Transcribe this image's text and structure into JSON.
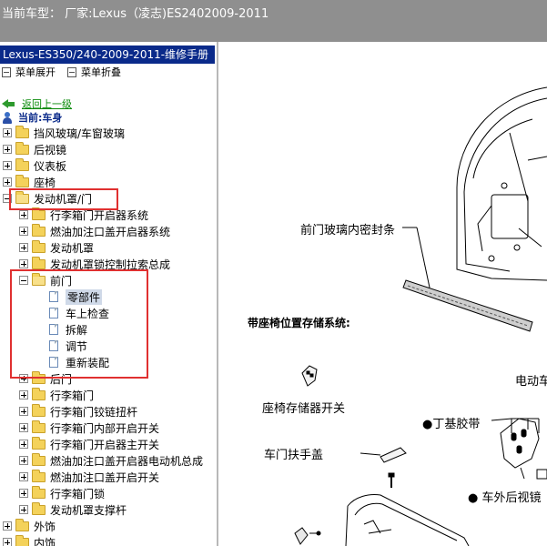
{
  "window": {
    "title": "当前车型：  厂家:Lexus（凌志)ES2402009-2011"
  },
  "manual": {
    "header": "Lexus-ES350/240-2009-2011-维修手册"
  },
  "toolbar": {
    "expand_label": "菜单展开",
    "collapse_label": "菜单折叠"
  },
  "nav": {
    "back_label": "返回上一级",
    "current_label": "当前:车身"
  },
  "tree": {
    "top_items": [
      "挡风玻璃/车窗玻璃",
      "后视镜",
      "仪表板",
      "座椅"
    ],
    "open_folder": "发动机罩/门",
    "children_a": [
      "行李箱门开启器系统",
      "燃油加注口盖开启器系统",
      "发动机罩",
      "发动机罩锁控制拉索总成"
    ],
    "front_door": "前门",
    "front_door_docs": [
      "零部件",
      "车上检查",
      "拆解",
      "调节",
      "重新装配"
    ],
    "children_b": [
      "后门",
      "行李箱门",
      "行李箱门铰链扭杆",
      "行李箱门内部开启开关",
      "行李箱门开启器主开关",
      "燃油加注口盖开启器电动机总成",
      "燃油加注口盖开启开关",
      "行李箱门锁",
      "发动机罩支撑杆"
    ],
    "bottom_items": [
      "外饰",
      "内饰"
    ]
  },
  "diagram": {
    "label_seal": "前门玻璃内密封条",
    "label_memory": "带座椅位置存储系统:",
    "label_electric": "电动车",
    "label_seat_switch": "座椅存储器开关",
    "label_butyl": "●丁基胶带",
    "label_handle": "车门扶手盖",
    "label_mirror": "● 车外后视镜"
  },
  "colors": {
    "titlebar": "#8f8f8f",
    "header": "#0a2a8a",
    "highlight": "#e03030"
  }
}
